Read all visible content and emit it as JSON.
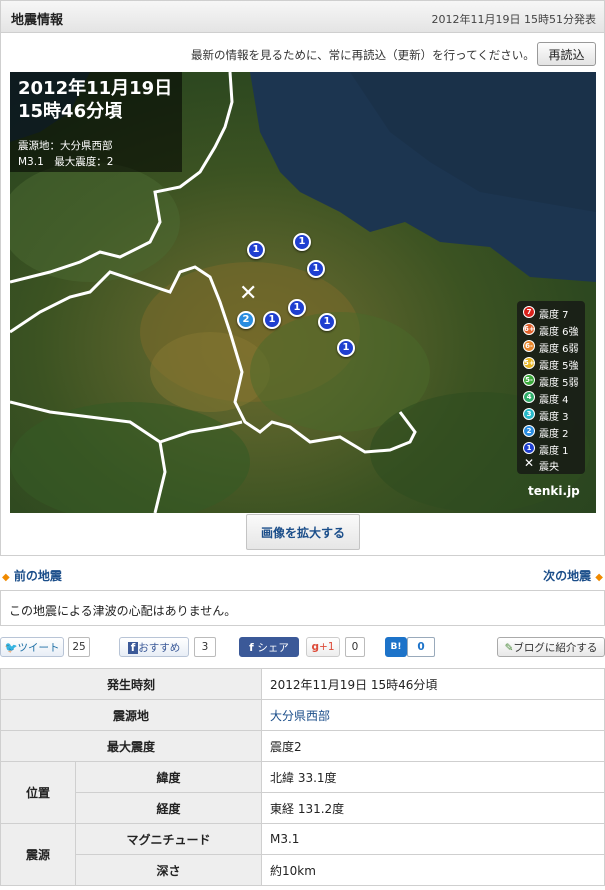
{
  "header": {
    "title": "地震情報",
    "issued": "2012年11月19日 15時51分発表"
  },
  "reload": {
    "text": "最新の情報を見るために、常に再読込（更新）を行ってください。",
    "button": "再読込"
  },
  "map": {
    "date": "2012年11月19日",
    "time": "15時46分頃",
    "epicenter": "震源地：大分県西部",
    "magnitude_line": "M3.1　最大震度：2",
    "credit": "tenki.jp",
    "enlarge_button": "画像を拡大する",
    "markers": [
      {
        "intensity": "1",
        "color": "#1f3fd0"
      },
      {
        "intensity": "1",
        "color": "#1f3fd0"
      },
      {
        "intensity": "1",
        "color": "#1f3fd0"
      },
      {
        "intensity": "2",
        "color": "#2a8de0"
      },
      {
        "intensity": "1",
        "color": "#1f3fd0"
      },
      {
        "intensity": "1",
        "color": "#1f3fd0"
      },
      {
        "intensity": "1",
        "color": "#1f3fd0"
      },
      {
        "intensity": "1",
        "color": "#1f3fd0"
      }
    ],
    "epicenter_mark": "✕",
    "legend": [
      {
        "num": "7",
        "label": "震度 7",
        "color": "#d8221a"
      },
      {
        "num": "6+",
        "label": "震度 6強",
        "color": "#e0602a"
      },
      {
        "num": "6-",
        "label": "震度 6弱",
        "color": "#e8862a"
      },
      {
        "num": "5+",
        "label": "震度 5強",
        "color": "#e6b420"
      },
      {
        "num": "5-",
        "label": "震度 5弱",
        "color": "#3aa83a"
      },
      {
        "num": "4",
        "label": "震度 4",
        "color": "#2fae6a"
      },
      {
        "num": "3",
        "label": "震度 3",
        "color": "#26b8c8"
      },
      {
        "num": "2",
        "label": "震度 2",
        "color": "#2a8de0"
      },
      {
        "num": "1",
        "label": "震度 1",
        "color": "#1f3fd0"
      }
    ],
    "legend_epicenter": {
      "mark": "✕",
      "label": "震央"
    }
  },
  "nav": {
    "prev": "前の地震",
    "next": "次の地震"
  },
  "tsunami": "この地震による津波の心配はありません。",
  "social": {
    "tweet": "ツイート",
    "tweet_count": "25",
    "fb_recommend": "おすすめ",
    "fb_count": "3",
    "share": "シェア",
    "gplus": "+1",
    "gplus_count": "0",
    "hatena": "B!",
    "hatena_count": "0",
    "blog": "ブログに紹介する"
  },
  "table": {
    "occurred_label": "発生時刻",
    "occurred": "2012年11月19日 15時46分頃",
    "epicenter_label": "震源地",
    "epicenter": "大分県西部",
    "max_label": "最大震度",
    "max": "震度2",
    "position_label": "位置",
    "lat_label": "緯度",
    "lat": "北緯 33.1度",
    "lon_label": "経度",
    "lon": "東経 131.2度",
    "source_label": "震源",
    "mag_label": "マグニチュード",
    "mag": "M3.1",
    "depth_label": "深さ",
    "depth": "約10km"
  }
}
